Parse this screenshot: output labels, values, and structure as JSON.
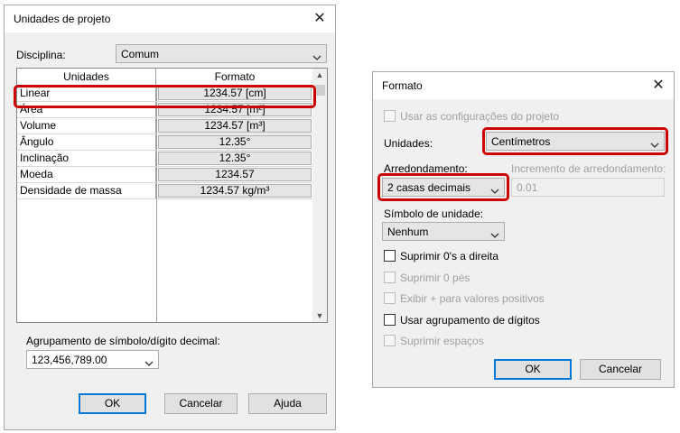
{
  "dialog1": {
    "title": "Unidades de projeto",
    "close_glyph": "✕",
    "discipline_label": "Disciplina:",
    "discipline_value": "Comum",
    "table": {
      "headers": [
        "Unidades",
        "Formato"
      ],
      "rows": [
        {
          "unit": "Linear",
          "format": "1234.57 [cm]"
        },
        {
          "unit": "Área",
          "format": "1234.57 [m²]"
        },
        {
          "unit": "Volume",
          "format": "1234.57 [m³]"
        },
        {
          "unit": "Ângulo",
          "format": "12.35°"
        },
        {
          "unit": "Inclinação",
          "format": "12.35°"
        },
        {
          "unit": "Moeda",
          "format": "1234.57"
        },
        {
          "unit": "Densidade de massa",
          "format": "1234.57 kg/m³"
        }
      ]
    },
    "grouping_label": "Agrupamento de símbolo/dígito decimal:",
    "grouping_value": "123,456,789.00",
    "ok": "OK",
    "cancel": "Cancelar",
    "help": "Ajuda"
  },
  "dialog2": {
    "title": "Formato",
    "close_glyph": "✕",
    "use_project_settings": "Usar as configurações do projeto",
    "units_label": "Unidades:",
    "units_value": "Centímetros",
    "rounding_label": "Arredondamento:",
    "rounding_value": "2 casas decimais",
    "rounding_increment_label": "Incremento de arredondamento:",
    "rounding_increment_value": "0.01",
    "unit_symbol_label": "Símbolo de unidade:",
    "unit_symbol_value": "Nenhum",
    "suppress_trailing_zeros": "Suprimir 0's a direita",
    "suppress_zero_feet": "Suprimir 0 pés",
    "show_plus": "Exibir + para valores positivos",
    "digit_grouping": "Usar agrupamento de dígitos",
    "suppress_spaces": "Suprimir espaços",
    "ok": "OK",
    "cancel": "Cancelar"
  },
  "highlight_color": "#cc0000",
  "icons": {
    "dropdown": "chevron-down-icon",
    "close": "close-icon"
  }
}
